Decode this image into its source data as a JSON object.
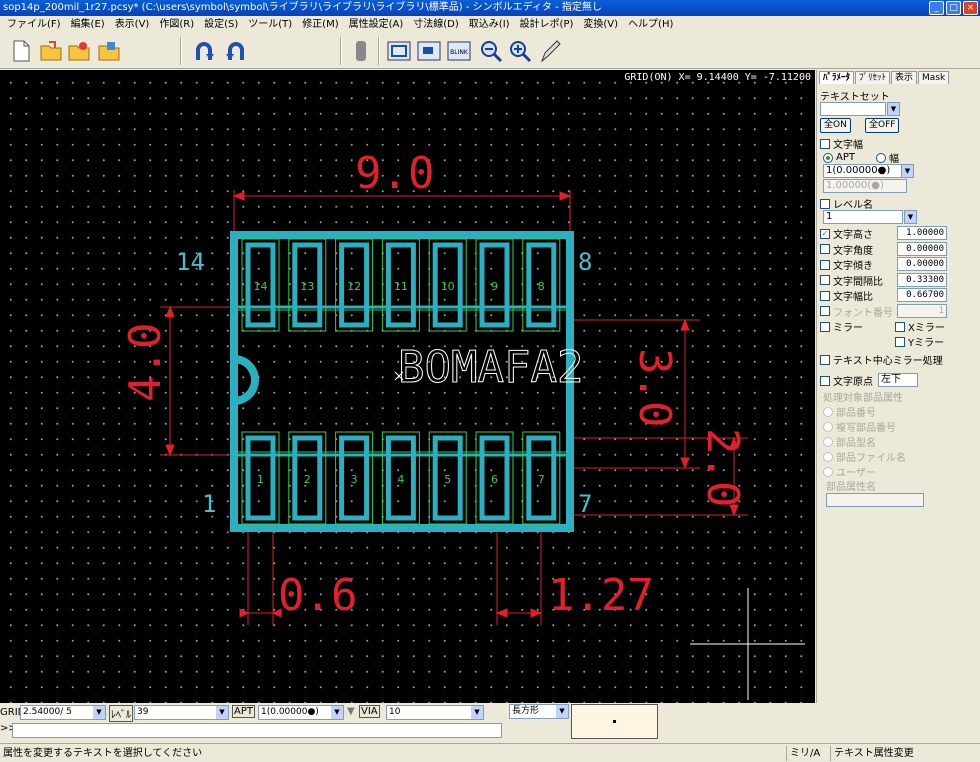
{
  "window": {
    "title": "sop14p_200mil_1r27.pcsy* (C:\\users\\symbol\\symbol\\ライブラリ\\ライブラリ\\ライブラリ\\標準品) - シンボルエディタ - 指定無し"
  },
  "menu": [
    "ファイル(F)",
    "編集(E)",
    "表示(V)",
    "作図(R)",
    "設定(S)",
    "ツール(T)",
    "修正(M)",
    "属性設定(A)",
    "寸法線(D)",
    "取込み(I)",
    "設計レポ(P)",
    "変換(V)",
    "ヘルプ(H)"
  ],
  "toolbar": {
    "blink": "BLINK"
  },
  "canvas": {
    "coord": "GRID(ON) X=  9.14400 Y= -7.11200",
    "dim_width": "9.0",
    "dim_height": "4.0",
    "dim_pad": "0.6",
    "dim_pitch": "1.27",
    "dim_r3": "3.0",
    "dim_r2": "2.0",
    "corner_14": "14",
    "corner_8": "8",
    "corner_1": "1",
    "corner_7": "7",
    "ref_text": "BOMAFA2",
    "top_pins": [
      "14",
      "13",
      "12",
      "11",
      "10",
      "9",
      "8"
    ],
    "bottom_pins": [
      "1",
      "2",
      "3",
      "4",
      "5",
      "6",
      "7"
    ]
  },
  "panel": {
    "tabs": [
      "ﾊﾟﾗﾒｰﾀ",
      "ﾌﾟﾘｾｯﾄ",
      "表示",
      "Mask"
    ],
    "textset_label": "テキストセット",
    "all_on": "全ON",
    "all_off": "全OFF",
    "char_width": "文字幅",
    "apt": "APT",
    "width": "幅",
    "apt_value": "1(0.00000●)",
    "width_value": "1.00000(●)",
    "level_name": "レベル名",
    "level_value": "1",
    "rows": [
      {
        "label": "文字高さ",
        "value": "1.00000",
        "checked": true,
        "disabled": false
      },
      {
        "label": "文字角度",
        "value": "0.00000",
        "checked": false,
        "disabled": false
      },
      {
        "label": "文字傾き",
        "value": "0.00000",
        "checked": false,
        "disabled": false
      },
      {
        "label": "文字間隔比",
        "value": "0.33300",
        "checked": false,
        "disabled": false
      },
      {
        "label": "文字幅比",
        "value": "0.66700",
        "checked": false,
        "disabled": false
      },
      {
        "label": "フォント番号",
        "value": "1",
        "checked": false,
        "disabled": true
      }
    ],
    "mirror": "ミラー",
    "xmirror": "Xミラー",
    "ymirror": "Yミラー",
    "center_mirror": "テキスト中心ミラー処理",
    "origin": "文字原点",
    "origin_value": "左下",
    "target_label": "処理対象部品属性",
    "targets": [
      "部品番号",
      "複写部品番号",
      "部品型名",
      "部品ファイル名",
      "ユーザー"
    ],
    "attr_name": "部品属性名"
  },
  "bottom": {
    "grid_label": "GRID",
    "grid_value": "2.54000/ 5",
    "level_label": "ﾚﾍﾞﾙ",
    "level_value": "39",
    "apt_label": "APT",
    "apt_value": "1(0.00000●)",
    "via_label": "VIA",
    "via_value": "10",
    "shape_value": "長方形",
    "prompt": ">>"
  },
  "status": {
    "message": "属性を変更するテキストを選択してください",
    "unit": "ミリ/A",
    "mode": "テキスト属性変更"
  }
}
